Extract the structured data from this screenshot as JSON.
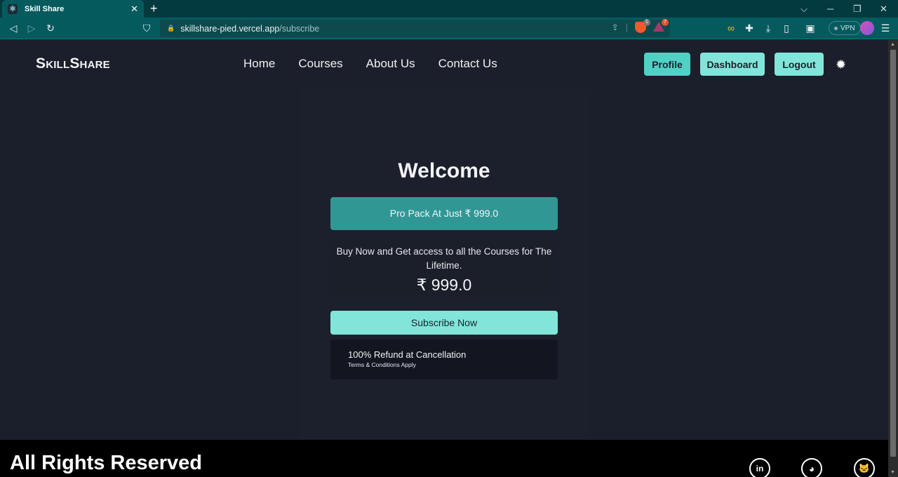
{
  "browser": {
    "tab_title": "Skill Share",
    "tab_favicon": "react-icon",
    "new_tab_icon": "+",
    "url_host": "skillshare-pied.vercel.app",
    "url_path": "/subscribe",
    "brave_shield_count": "1",
    "rewards_count": "7",
    "vpn_label": "VPN"
  },
  "navbar": {
    "logo": "SkillShare",
    "links": [
      "Home",
      "Courses",
      "About Us",
      "Contact Us"
    ],
    "buttons": [
      "Profile",
      "Dashboard",
      "Logout"
    ],
    "theme_icon": "sun-icon"
  },
  "main": {
    "heading": "Welcome",
    "banner": "Pro Pack At Just ₹ 999.0",
    "description": "Buy Now and Get access to all the Courses for The Lifetime.",
    "price": "₹ 999.0",
    "subscribe_label": "Subscribe Now",
    "refund_title": "100% Refund at Cancellation",
    "refund_note": "Terms & Conditions Apply"
  },
  "footer": {
    "rights": "All Rights Reserved",
    "social": [
      "linkedin",
      "dribbble",
      "github"
    ]
  },
  "colors": {
    "accent": "#81e6d9",
    "accent_active": "#4fd1c5",
    "banner": "#319795",
    "background": "#1b1f2b"
  }
}
